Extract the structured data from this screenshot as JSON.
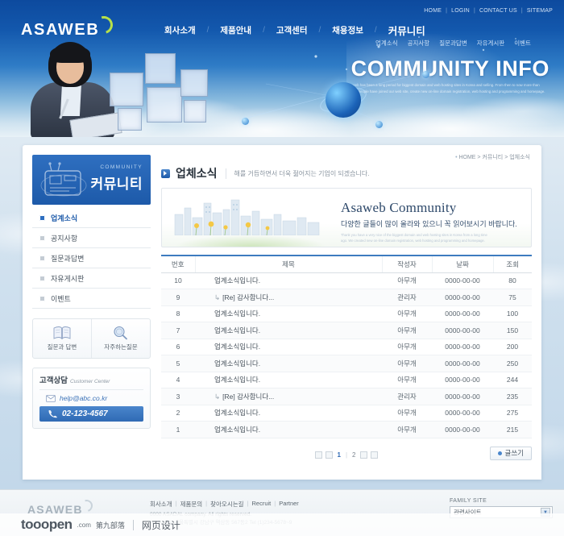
{
  "header": {
    "logo": "ASAWEB",
    "top_links": [
      "HOME",
      "LOGIN",
      "CONTACT US",
      "SITEMAP"
    ],
    "main_nav": [
      "회사소개",
      "제품안내",
      "고객센터",
      "채용정보",
      "커뮤니티"
    ],
    "sub_nav": [
      "업계소식",
      "공지사항",
      "질문과답변",
      "자유게시판",
      "이벤트"
    ],
    "hero_title": "COMMUNITY INFO",
    "hero_sub": "Asaweb has been a long period for biggest domain and web hosting sites in Korea and selling. From then to now more than 20,000 people have joined our web site, create new on-line domain registration, web hosting and programming and homepage."
  },
  "sidebar": {
    "head_label": "COMMUNITY",
    "head_title": "커뮤니티",
    "items": [
      {
        "label": "업계소식",
        "active": true
      },
      {
        "label": "공지사항",
        "active": false
      },
      {
        "label": "질문과답변",
        "active": false
      },
      {
        "label": "자유게시판",
        "active": false
      },
      {
        "label": "이벤트",
        "active": false
      }
    ],
    "quick_links": [
      {
        "label": "질문과 답변",
        "icon": "book-icon"
      },
      {
        "label": "자주하는질문",
        "icon": "magnifier-icon"
      }
    ],
    "customer_center": {
      "title_ko": "고객상담",
      "title_en": "Customer Center",
      "email": "help@abc.co.kr",
      "phone": "02-123-4567"
    }
  },
  "main": {
    "breadcrumb": [
      "HOME",
      "커뮤니티",
      "업체소식"
    ],
    "page_title": "업체소식",
    "page_subtitle": "해를 거듭하면서 더욱 젊어지는 기업이 되겠습니다.",
    "banner": {
      "title": "Asaweb Community",
      "subtitle": "다양한 글들이 많이 올라와 있으니 꼭 읽어보시기 바랍니다.",
      "fine_print": "Thank you have a very nice of the biggest domain and web hosting sites in Korea from a long time ago. We created new on-line domain registration, web hosting and programming and homepage."
    },
    "table": {
      "headers": [
        "번호",
        "제목",
        "작성자",
        "날짜",
        "조회"
      ],
      "rows": [
        {
          "no": "10",
          "subject": "업계소식입니다.",
          "reply": false,
          "writer": "아무개",
          "date": "0000-00-00",
          "hits": "80"
        },
        {
          "no": "9",
          "subject": "[Re] 감사합니다...",
          "reply": true,
          "writer": "관리자",
          "date": "0000-00-00",
          "hits": "75"
        },
        {
          "no": "8",
          "subject": "업계소식입니다.",
          "reply": false,
          "writer": "아무개",
          "date": "0000-00-00",
          "hits": "100"
        },
        {
          "no": "7",
          "subject": "업계소식입니다.",
          "reply": false,
          "writer": "아무개",
          "date": "0000-00-00",
          "hits": "150"
        },
        {
          "no": "6",
          "subject": "업계소식입니다.",
          "reply": false,
          "writer": "아무개",
          "date": "0000-00-00",
          "hits": "200"
        },
        {
          "no": "5",
          "subject": "업계소식입니다.",
          "reply": false,
          "writer": "아무개",
          "date": "0000-00-00",
          "hits": "250"
        },
        {
          "no": "4",
          "subject": "업계소식입니다.",
          "reply": false,
          "writer": "아무개",
          "date": "0000-00-00",
          "hits": "244"
        },
        {
          "no": "3",
          "subject": "[Re] 감사합니다...",
          "reply": true,
          "writer": "관리자",
          "date": "0000-00-00",
          "hits": "235"
        },
        {
          "no": "2",
          "subject": "업계소식입니다.",
          "reply": false,
          "writer": "아무개",
          "date": "0000-00-00",
          "hits": "275"
        },
        {
          "no": "1",
          "subject": "업계소식입니다.",
          "reply": false,
          "writer": "아무개",
          "date": "0000-00-00",
          "hits": "215"
        }
      ]
    },
    "pagination": {
      "pages": [
        "1",
        "2"
      ],
      "current": "1"
    },
    "write_button": "글쓰기"
  },
  "footer": {
    "logo": "ASAWEB",
    "links": [
      "회사소개",
      "제품문의",
      "찾아오시는길",
      "Recruit",
      "Partner"
    ],
    "copyright": "0000 ASADAL company. All rights reserved.",
    "address": "(123-456) 서울특별시 강남구 역삼동 567동2 Tel (1)234-5678~9",
    "family_site_label": "FAMILY SITE",
    "family_site_value": "관련사이트"
  },
  "watermark": {
    "brand": "tooopen",
    "com": ".com",
    "cn": "第九部落",
    "cn2": "网页设计"
  },
  "colors": {
    "brand_blue": "#1d5aa9",
    "accent_blue": "#3d7cc0",
    "logo_green": "#b6e04a"
  }
}
